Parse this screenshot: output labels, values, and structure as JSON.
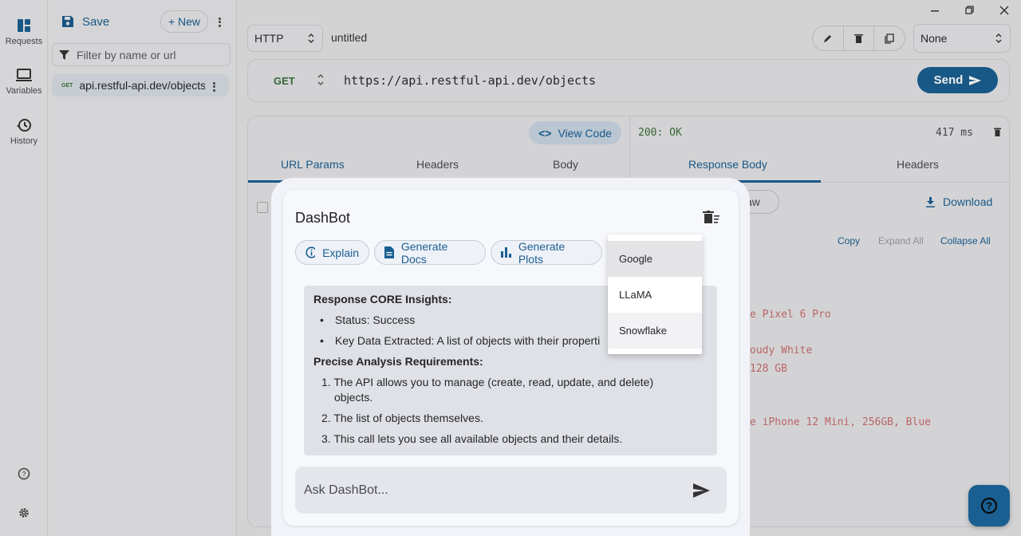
{
  "rail": {
    "requests": "Requests",
    "variables": "Variables",
    "history": "History"
  },
  "collections": {
    "save": "Save",
    "new": "+ New",
    "filter_placeholder": "Filter by name or url",
    "item_method": "GET",
    "item_url": "api.restful-api.dev/objects"
  },
  "request": {
    "protocol": "HTTP",
    "name": "untitled",
    "env": "None",
    "method": "GET",
    "url": "https://api.restful-api.dev/objects",
    "send": "Send",
    "view_code": "View Code",
    "tabs": [
      "URL Params",
      "Headers",
      "Body"
    ]
  },
  "response": {
    "status": "200: OK",
    "time": "417 ms",
    "tabs": [
      "Response Body",
      "Headers"
    ],
    "raw_chip": "aw",
    "download": "Download",
    "copy": "Copy",
    "expand_all": "Expand All",
    "collapse_all": "Collapse All",
    "peeks": [
      "e Pixel 6 Pro",
      "oudy White",
      "128 GB",
      "e iPhone 12 Mini, 256GB, Blue"
    ]
  },
  "dashbot": {
    "title": "DashBot",
    "chips": [
      "Explain",
      "Generate Docs",
      "Generate Plots"
    ],
    "insight_title": "Response CORE Insights:",
    "bullets": [
      "Status: Success",
      "Key Data Extracted: A list of objects with their properti"
    ],
    "req_title": "Precise Analysis Requirements:",
    "numbered": [
      "1. The API allows you to manage (create, read, update, and delete)",
      "objects.",
      "2. The list of objects themselves.",
      "3. This call lets you see all available objects and their details."
    ],
    "ask_placeholder": "Ask DashBot..."
  },
  "model_menu": [
    "Google",
    "LLaMA",
    "Snowflake"
  ],
  "colors": {
    "accent": "#1a5f91",
    "success": "#3b6f3b"
  }
}
